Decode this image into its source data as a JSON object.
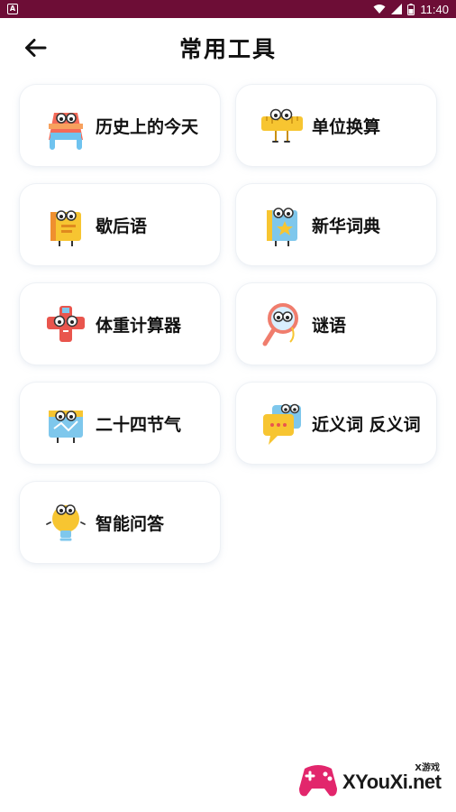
{
  "status_bar": {
    "time": "11:40",
    "notification_icon": "android-notification-icon",
    "bg_color": "#6d0d36"
  },
  "header": {
    "title": "常用工具",
    "back_icon": "arrow-left-icon"
  },
  "tools": [
    {
      "label": "历史上的今天",
      "icon": "history-character-icon"
    },
    {
      "label": "单位换算",
      "icon": "ruler-character-icon"
    },
    {
      "label": "歇后语",
      "icon": "book-character-icon"
    },
    {
      "label": "新华词典",
      "icon": "dictionary-character-icon"
    },
    {
      "label": "体重计算器",
      "icon": "scale-character-icon"
    },
    {
      "label": "谜语",
      "icon": "magnifier-character-icon"
    },
    {
      "label": "二十四节气",
      "icon": "calendar-character-icon"
    },
    {
      "label": "近义词 反义词",
      "icon": "speech-bubble-character-icon"
    },
    {
      "label": "智能问答",
      "icon": "lightbulb-character-icon"
    }
  ],
  "watermark": {
    "small_text": "X游戏",
    "main_text": "XYouXi.net"
  }
}
